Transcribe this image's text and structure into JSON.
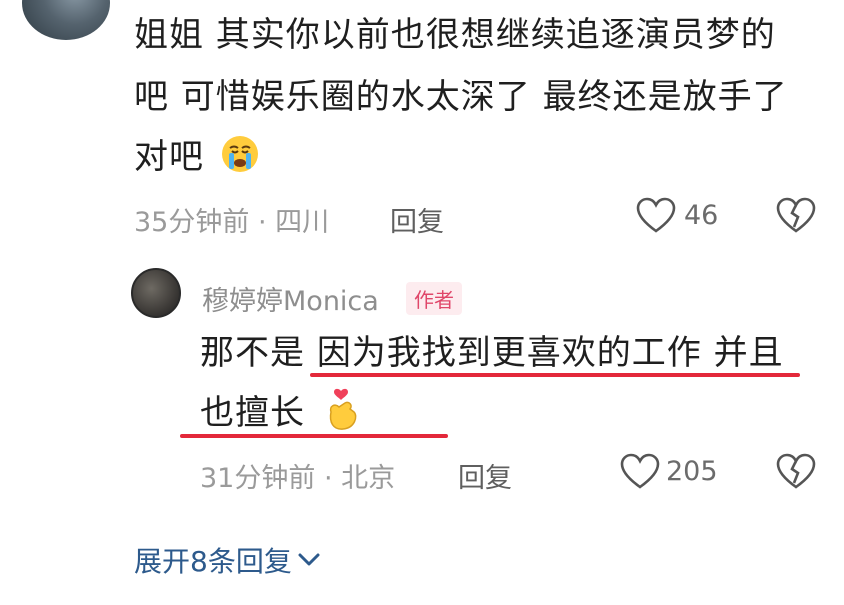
{
  "comment": {
    "lines": [
      "姐姐 其实你以前也很想继续追逐演员梦的",
      "吧 可惜娱乐圈的水太深了 最终还是放手了",
      "对吧"
    ],
    "emoji": "crying-face-emoji",
    "meta": "35分钟前 · 四川",
    "reply_label": "回复",
    "like_count": "46"
  },
  "reply": {
    "author": "穆婷婷Monica",
    "badge": "作者",
    "line1_prefix": "那不是 ",
    "line1_highlight": "因为我找到更喜欢的工作 并且",
    "line2": "也擅长",
    "emoji": "finger-heart-emoji",
    "meta": "31分钟前 · 北京",
    "reply_label": "回复",
    "like_count": "205",
    "underline_color": "#e3283a"
  },
  "expand": {
    "label": "展开8条回复"
  },
  "colors": {
    "link": "#2d5a8c",
    "badge_text": "#e0476a",
    "badge_bg": "#fdecef"
  }
}
